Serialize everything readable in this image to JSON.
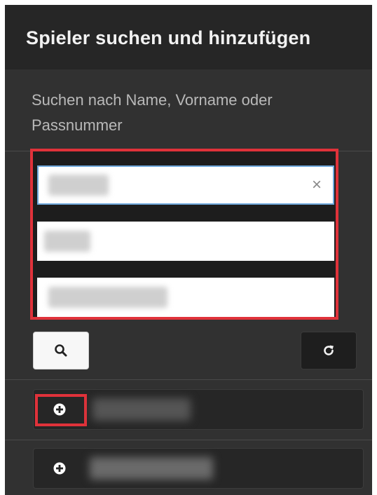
{
  "header": {
    "title": "Spieler suchen und hinzufügen"
  },
  "description": "Suchen nach Name, Vorname oder Passnummer",
  "fields": [
    {
      "id": "name",
      "value": "",
      "clear_symbol": "×"
    },
    {
      "id": "vorname",
      "value": ""
    },
    {
      "id": "passnummer",
      "value": ""
    }
  ],
  "buttons": {
    "search_icon": "search-icon",
    "refresh_icon": "refresh-icon"
  },
  "results": [
    {
      "add_icon": "plus-circle-icon",
      "name": ""
    },
    {
      "add_icon": "plus-circle-icon",
      "name": ""
    }
  ],
  "colors": {
    "panel_bg": "#313131",
    "header_bg": "#262626",
    "highlight": "#e0323a",
    "focus_border": "#6fa8dc"
  }
}
